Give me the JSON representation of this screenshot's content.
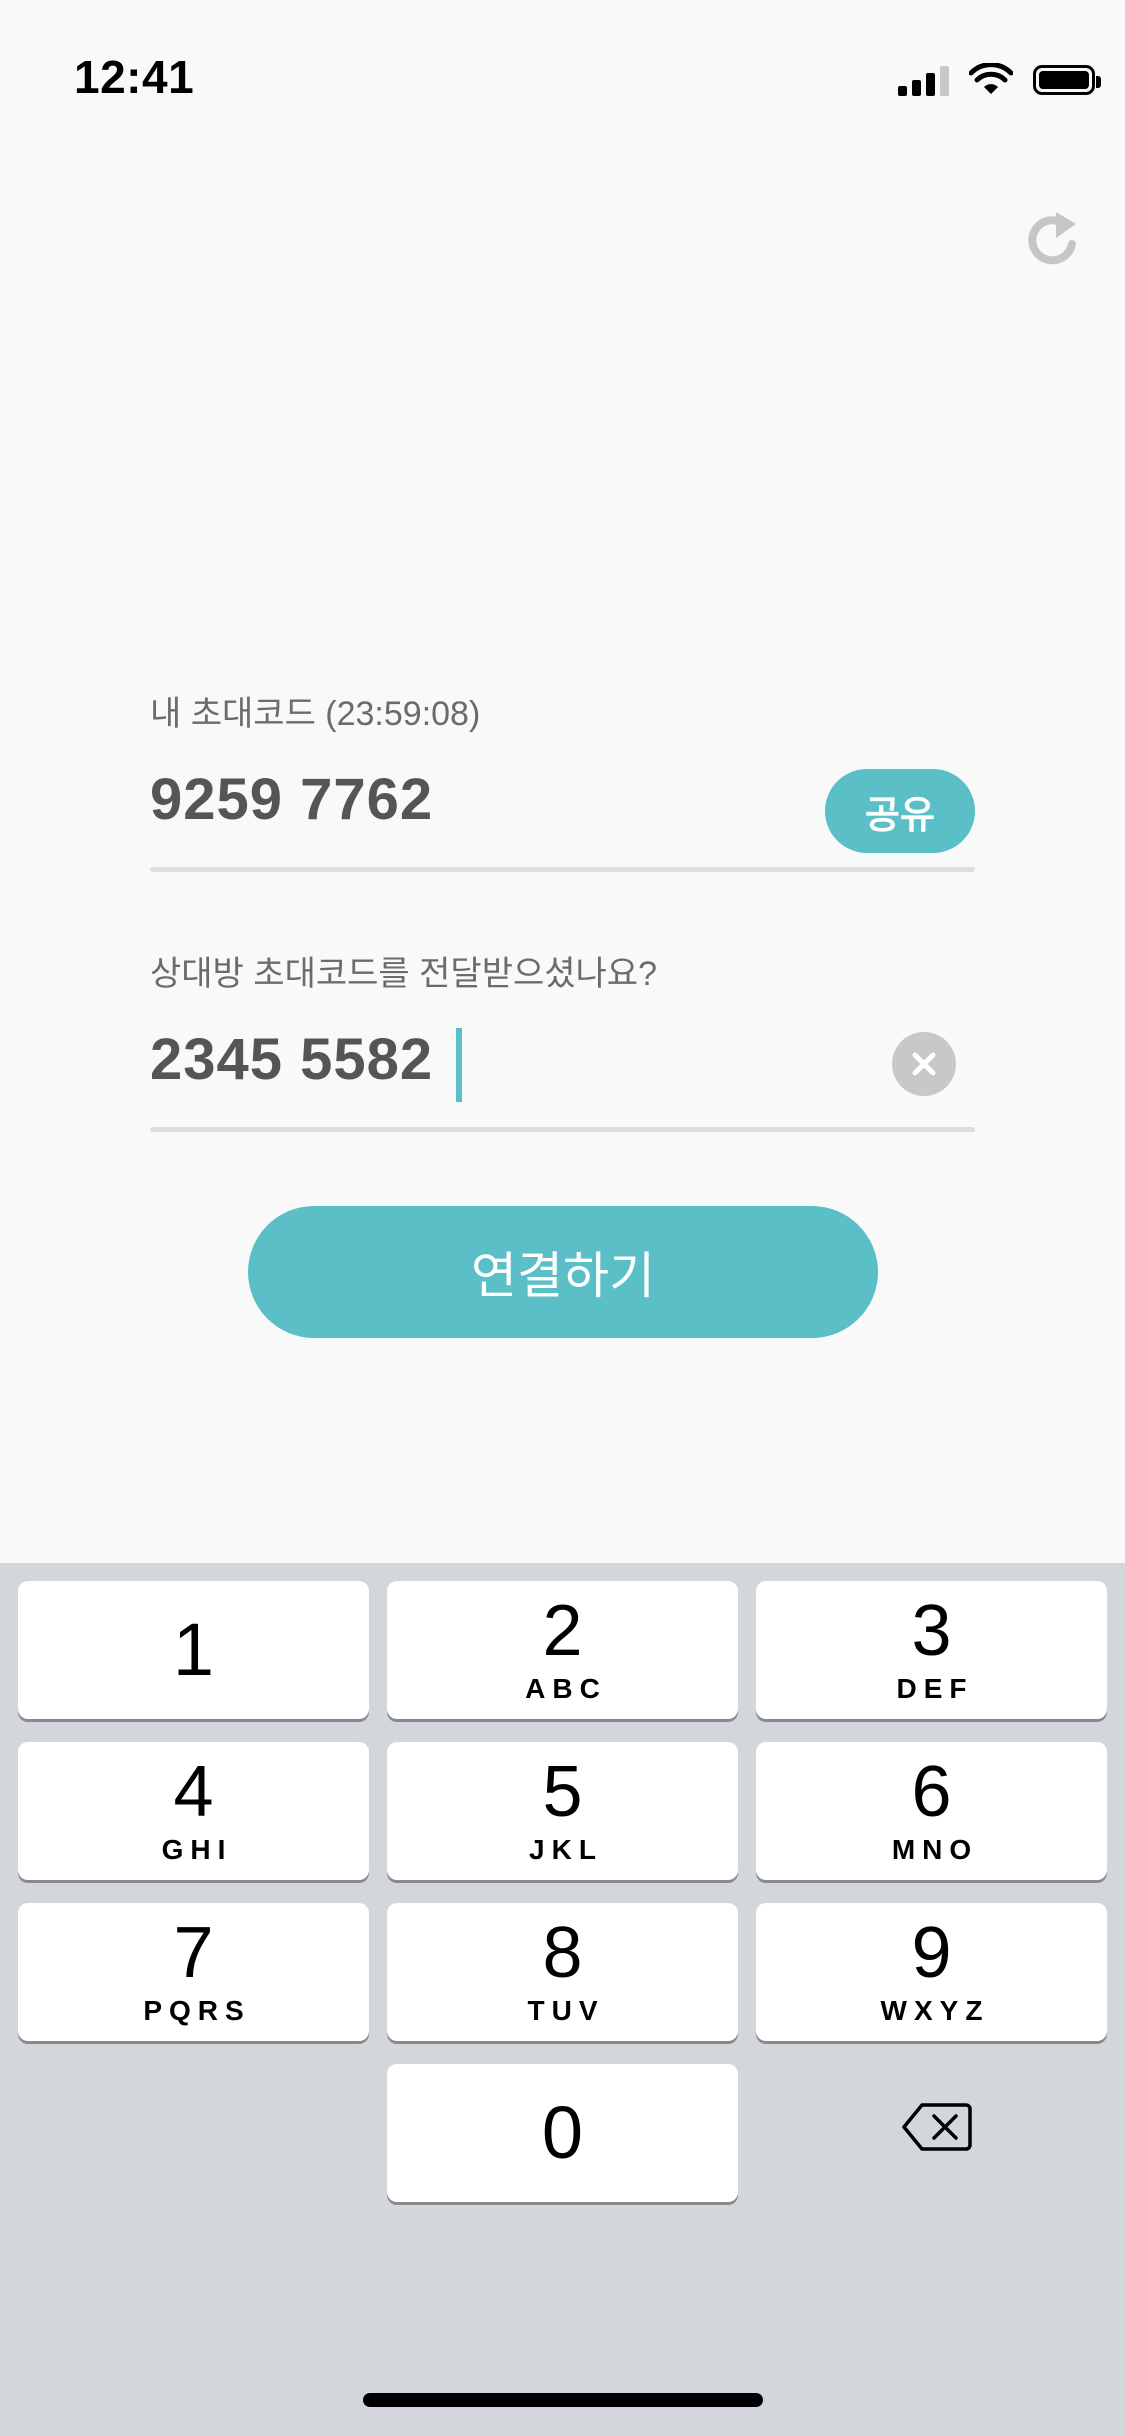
{
  "status_bar": {
    "time": "12:41"
  },
  "invite": {
    "my_code_label": "내 초대코드 (23:59:08)",
    "my_code_value": "9259 7762",
    "share_label": "공유",
    "partner_code_label": "상대방 초대코드를 전달받으셨나요?",
    "partner_code_value": "2345 5582",
    "connect_label": "연결하기"
  },
  "keypad": {
    "keys": [
      {
        "digit": "1",
        "letters": ""
      },
      {
        "digit": "2",
        "letters": "ABC"
      },
      {
        "digit": "3",
        "letters": "DEF"
      },
      {
        "digit": "4",
        "letters": "GHI"
      },
      {
        "digit": "5",
        "letters": "JKL"
      },
      {
        "digit": "6",
        "letters": "MNO"
      },
      {
        "digit": "7",
        "letters": "PQRS"
      },
      {
        "digit": "8",
        "letters": "TUV"
      },
      {
        "digit": "9",
        "letters": "WXYZ"
      },
      {
        "digit": "0",
        "letters": ""
      }
    ]
  },
  "colors": {
    "accent": "#5bbfc7",
    "background": "#f9f9f9",
    "keypad_bg": "#d3d6db"
  },
  "icons": [
    "signal-icon",
    "wifi-icon",
    "battery-icon",
    "refresh-icon",
    "clear-icon",
    "delete-icon"
  ]
}
